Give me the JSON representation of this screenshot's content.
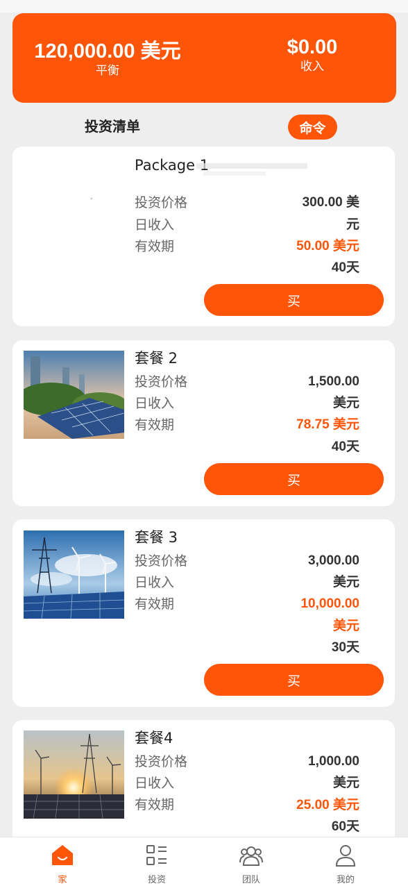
{
  "balance": {
    "amount": "120,000.00 美元",
    "label": "平衡"
  },
  "income": {
    "amount": "$0.00",
    "label": "收入"
  },
  "list": {
    "title": "投资清单",
    "command_label": "命令"
  },
  "labels": {
    "price": "投资价格",
    "daily": "日收入",
    "validity": "有效期",
    "buy": "买"
  },
  "packages": [
    {
      "name": "Package 1",
      "image": "blank-image",
      "values": [
        "300.00 美",
        "元"
      ],
      "daily": [
        "50.00 美元"
      ],
      "days": "40天"
    },
    {
      "name": "套餐 2",
      "image": "city-solar-panels-image",
      "values": [
        "1,500.00",
        "美元"
      ],
      "daily": [
        "78.75 美元"
      ],
      "days": "40天"
    },
    {
      "name": "套餐 3",
      "image": "wind-turbines-power-tower-image",
      "values": [
        "3,000.00",
        "美元"
      ],
      "daily": [
        "10,000.00",
        "美元"
      ],
      "days": "30天"
    },
    {
      "name": "套餐4",
      "image": "sunset-wind-solar-image",
      "values": [
        "1,000.00",
        "美元"
      ],
      "daily": [
        "25.00 美元"
      ],
      "days": "60天"
    }
  ],
  "tabs": [
    {
      "label": "家",
      "icon": "home-icon"
    },
    {
      "label": "投资",
      "icon": "grid-list-icon"
    },
    {
      "label": "团队",
      "icon": "team-icon"
    },
    {
      "label": "我的",
      "icon": "user-icon"
    }
  ],
  "colors": {
    "accent": "#fe5508",
    "background": "#eeeeee"
  }
}
